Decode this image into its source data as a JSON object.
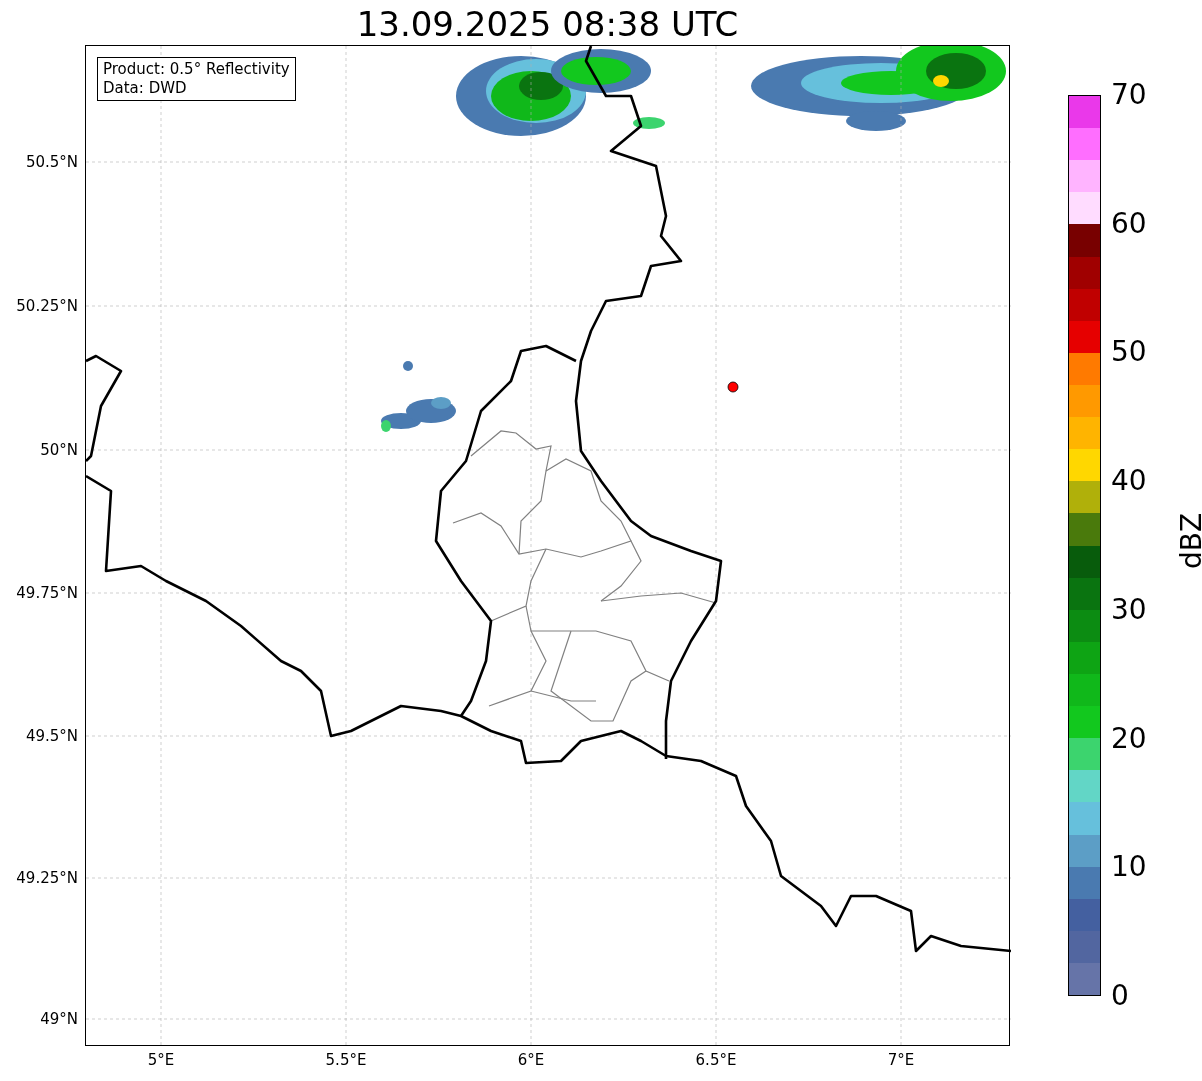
{
  "title": "13.09.2025 08:38 UTC",
  "legend": {
    "lines": [
      "Product: 0.5° Reflectivity",
      "Data: DWD"
    ]
  },
  "y_ticks": [
    "50.5°N",
    "50.25°N",
    "50°N",
    "49.75°N",
    "49.5°N",
    "49.25°N",
    "49°N"
  ],
  "x_ticks": [
    "5°E",
    "5.5°E",
    "6°E",
    "6.5°E",
    "7°E"
  ],
  "colorbar": {
    "label": "dBZ",
    "ticks": [
      "70",
      "60",
      "50",
      "40",
      "30",
      "20",
      "10",
      "0"
    ],
    "bands": [
      {
        "color": "#ea38ea"
      },
      {
        "color": "#ff6eff"
      },
      {
        "color": "#ffb4ff"
      },
      {
        "color": "#ffdcff"
      },
      {
        "color": "#780000"
      },
      {
        "color": "#a00000"
      },
      {
        "color": "#c00000"
      },
      {
        "color": "#e60000"
      },
      {
        "color": "#ff7a00"
      },
      {
        "color": "#ff9900"
      },
      {
        "color": "#ffb400"
      },
      {
        "color": "#ffd700"
      },
      {
        "color": "#b0b00a"
      },
      {
        "color": "#4a7a0c"
      },
      {
        "color": "#085c0c"
      },
      {
        "color": "#0a7410"
      },
      {
        "color": "#0c8c12"
      },
      {
        "color": "#0ea414"
      },
      {
        "color": "#10b81a"
      },
      {
        "color": "#12c81e"
      },
      {
        "color": "#3cd46e"
      },
      {
        "color": "#62d6c6"
      },
      {
        "color": "#66c0dc"
      },
      {
        "color": "#5c9ec6"
      },
      {
        "color": "#4a7ab0"
      },
      {
        "color": "#4460a0"
      },
      {
        "color": "#5266a0"
      },
      {
        "color": "#6674a8"
      }
    ]
  }
}
